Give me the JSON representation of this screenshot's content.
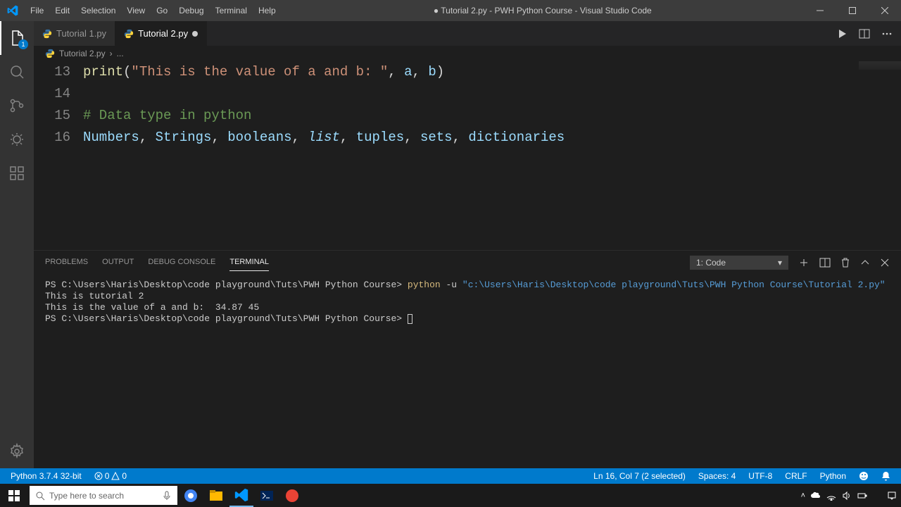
{
  "titlebar": {
    "menu": [
      "File",
      "Edit",
      "Selection",
      "View",
      "Go",
      "Debug",
      "Terminal",
      "Help"
    ],
    "title": "● Tutorial 2.py - PWH Python Course - Visual Studio Code"
  },
  "activity": {
    "badge": "1"
  },
  "tabs": {
    "items": [
      {
        "label": "Tutorial 1.py",
        "active": false,
        "dirty": false
      },
      {
        "label": "Tutorial 2.py",
        "active": true,
        "dirty": true
      }
    ]
  },
  "breadcrumb": {
    "file": "Tutorial 2.py",
    "sep": "›",
    "more": "..."
  },
  "editor": {
    "lines": [
      {
        "num": "13",
        "tokens": [
          {
            "t": "print",
            "c": "tok-fn"
          },
          {
            "t": "(",
            "c": "tok-punc"
          },
          {
            "t": "\"This is the value of a and b: \"",
            "c": "tok-str"
          },
          {
            "t": ", ",
            "c": "tok-punc"
          },
          {
            "t": "a",
            "c": "tok-var"
          },
          {
            "t": ", ",
            "c": "tok-punc"
          },
          {
            "t": "b",
            "c": "tok-var"
          },
          {
            "t": ")",
            "c": "tok-punc"
          }
        ]
      },
      {
        "num": "14",
        "tokens": []
      },
      {
        "num": "15",
        "tokens": [
          {
            "t": "# Data type in python",
            "c": "tok-comment"
          }
        ]
      },
      {
        "num": "16",
        "tokens": [
          {
            "t": "Numbers",
            "c": "tok-var"
          },
          {
            "t": ", ",
            "c": "tok-punc"
          },
          {
            "t": "Strings",
            "c": "tok-var"
          },
          {
            "t": ", ",
            "c": "tok-punc"
          },
          {
            "t": "booleans",
            "c": "tok-var"
          },
          {
            "t": ", ",
            "c": "tok-punc"
          },
          {
            "t": "list",
            "c": "tok-ital"
          },
          {
            "t": ", ",
            "c": "tok-punc"
          },
          {
            "t": "tuples",
            "c": "tok-var"
          },
          {
            "t": ", ",
            "c": "tok-punc"
          },
          {
            "t": "sets",
            "c": "tok-var"
          },
          {
            "t": ", ",
            "c": "tok-punc"
          },
          {
            "t": "dictionaries",
            "c": "tok-var"
          }
        ]
      }
    ]
  },
  "panel": {
    "tabs": [
      "PROBLEMS",
      "OUTPUT",
      "DEBUG CONSOLE",
      "TERMINAL"
    ],
    "active": 3,
    "selector": "1: Code"
  },
  "terminal": {
    "lines": [
      [
        {
          "t": "PS C:\\Users\\Haris\\Desktop\\code playground\\Tuts\\PWH Python Course> ",
          "c": "term-g"
        },
        {
          "t": "python ",
          "c": "term-y"
        },
        {
          "t": "-u ",
          "c": "term-g"
        },
        {
          "t": "\"c:\\Users\\Haris\\Desktop\\code playground\\Tuts\\PWH Python Course\\Tutorial 2.py\"",
          "c": "term-c"
        }
      ],
      [
        {
          "t": "This is tutorial 2",
          "c": "term-g"
        }
      ],
      [
        {
          "t": "This is the value of a and b:  34.87 45",
          "c": "term-g"
        }
      ],
      [
        {
          "t": "PS C:\\Users\\Haris\\Desktop\\code playground\\Tuts\\PWH Python Course> ",
          "c": "term-g"
        }
      ]
    ]
  },
  "status": {
    "python": "Python 3.7.4 32-bit",
    "errors": "0",
    "warnings": "0",
    "position": "Ln 16, Col 7 (2 selected)",
    "spaces": "Spaces: 4",
    "encoding": "UTF-8",
    "eol": "CRLF",
    "lang": "Python"
  },
  "taskbar": {
    "search_placeholder": "Type here to search",
    "time": "",
    "date": ""
  }
}
